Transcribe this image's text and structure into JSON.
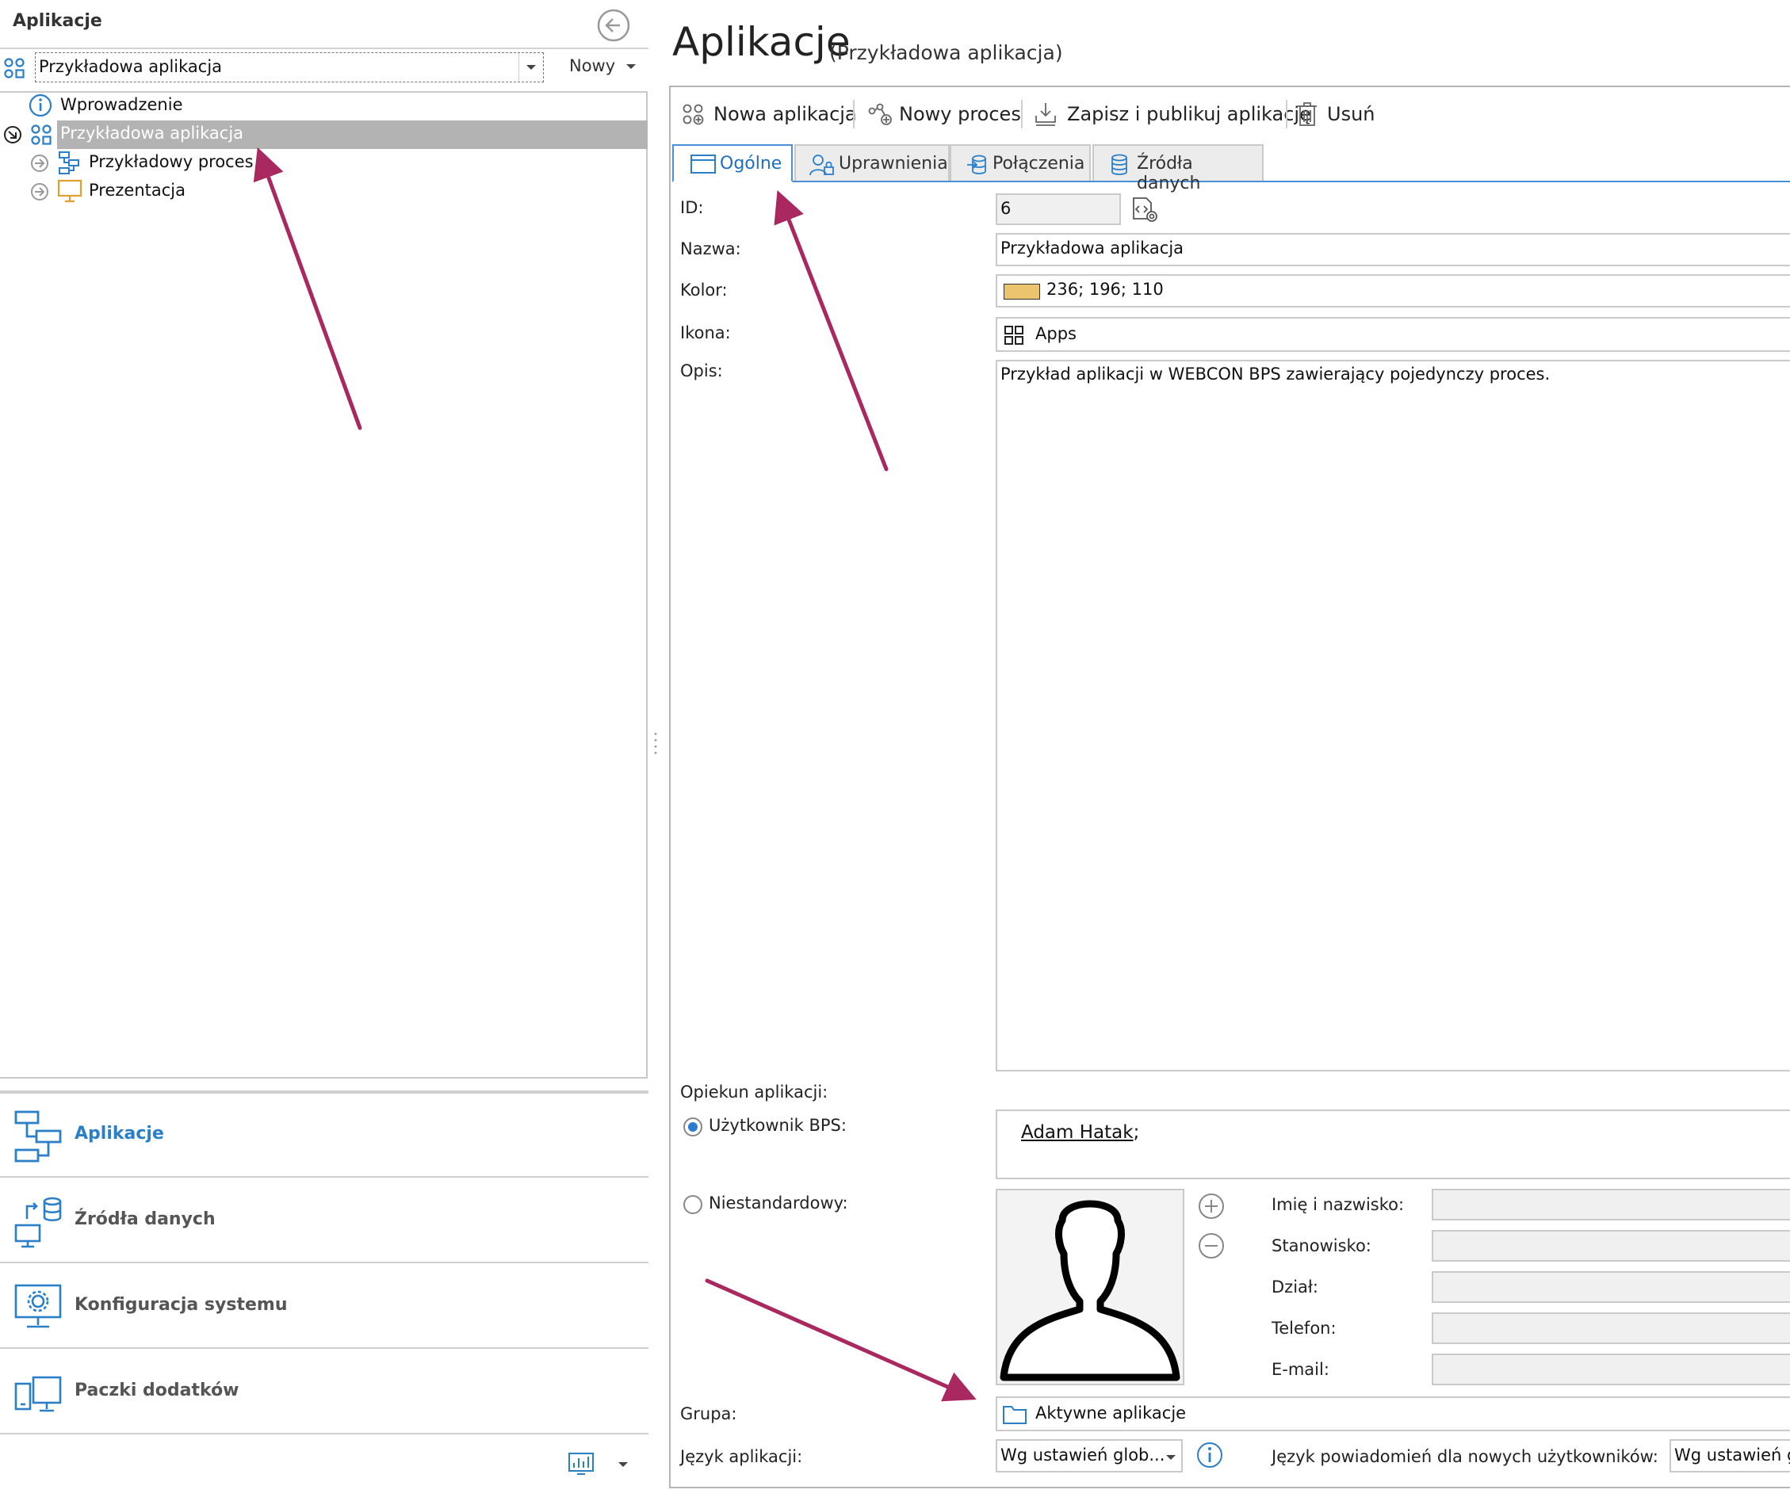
{
  "left_panel": {
    "title": "Aplikacje",
    "app_selector": {
      "value": "Przykładowa aplikacja"
    },
    "new_button_label": "Nowy",
    "tree": [
      {
        "label": "Wprowadzenie"
      },
      {
        "label": "Przykładowa aplikacja",
        "selected": true
      },
      {
        "label": "Przykładowy proces"
      },
      {
        "label": "Prezentacja"
      }
    ],
    "nav": [
      {
        "label": "Aplikacje",
        "active": true
      },
      {
        "label": "Źródła danych"
      },
      {
        "label": "Konfiguracja systemu"
      },
      {
        "label": "Paczki dodatków"
      }
    ]
  },
  "header": {
    "title": "Aplikacje",
    "subtitle": "(Przykładowa aplikacja)"
  },
  "toolbar": {
    "new_app": "Nowa aplikacja",
    "new_process": "Nowy proces",
    "save_publish": "Zapisz i publikuj aplikację",
    "delete": "Usuń"
  },
  "tabs": [
    {
      "label": "Ogólne",
      "active": true
    },
    {
      "label": "Uprawnienia"
    },
    {
      "label": "Połączenia"
    },
    {
      "label": "Źródła danych"
    }
  ],
  "form": {
    "id_label": "ID:",
    "id_value": "6",
    "name_label": "Nazwa:",
    "name_value": "Przykładowa aplikacja",
    "color_label": "Kolor:",
    "color_value": "236; 196; 110",
    "color_hex": "#ecc46e",
    "icon_label": "Ikona:",
    "icon_value": "Apps",
    "desc_label": "Opis:",
    "desc_value": "Przykład aplikacji w WEBCON BPS zawierający pojedynczy proces.",
    "owner_label": "Opiekun aplikacji:",
    "bps_user_label": "Użytkownik BPS:",
    "bps_user_value": "Adam Hatak",
    "bps_user_suffix": ";",
    "custom_label": "Niestandardowy:",
    "person_fields": {
      "name": "Imię i nazwisko:",
      "position": "Stanowisko:",
      "department": "Dział:",
      "phone": "Telefon:",
      "email": "E-mail:"
    },
    "group_label": "Grupa:",
    "group_value": "Aktywne aplikacje",
    "lang_label": "Język aplikacji:",
    "lang_value": "Wg ustawień glob...",
    "notify_lang_label": "Język powiadomień dla nowych użytkowników:",
    "notify_lang_value": "Wg ustawień gl"
  },
  "colors": {
    "accent": "#2a7fc9",
    "annotation_arrow": "#a8285f",
    "selection": "#b3b3b3"
  }
}
